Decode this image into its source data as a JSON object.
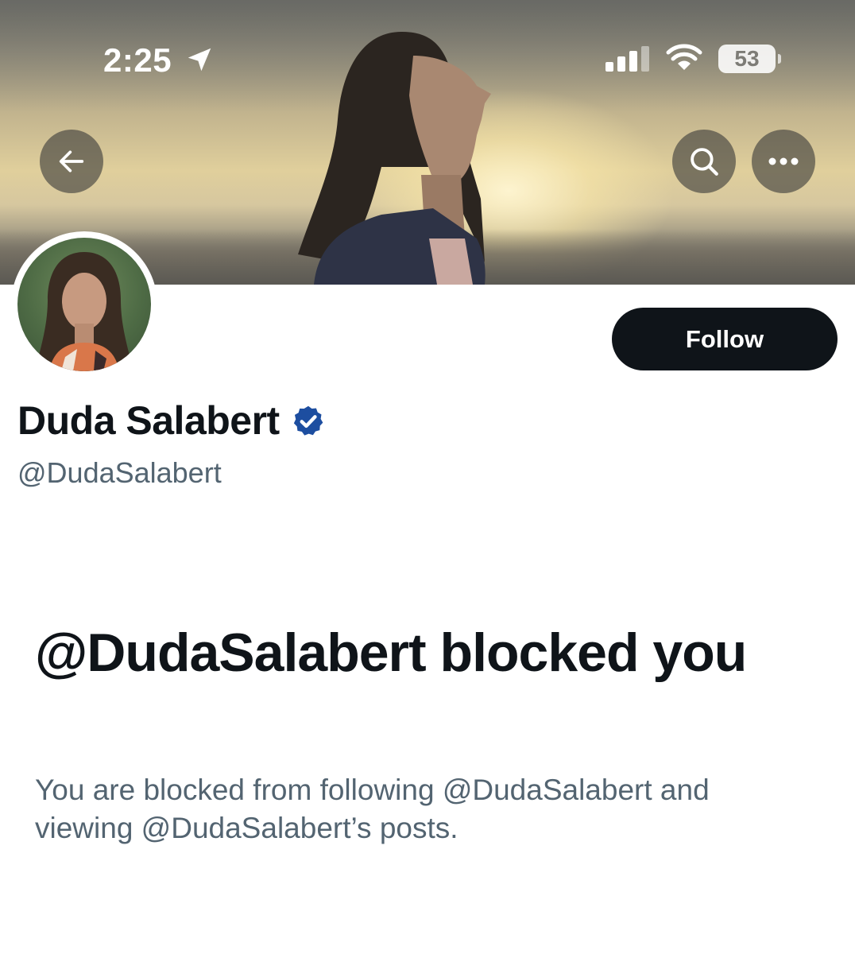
{
  "status_bar": {
    "time": "2:25",
    "battery": "53",
    "icons": [
      "location-arrow-icon",
      "cellular-signal-icon",
      "wifi-icon",
      "battery-icon"
    ]
  },
  "nav": {
    "back_icon": "arrow-left-icon",
    "search_icon": "search-icon",
    "more_icon": "more-horizontal-icon"
  },
  "profile": {
    "display_name": "Duda Salabert",
    "handle": "@DudaSalabert",
    "verified": true,
    "verified_color": "#1d4ea0",
    "follow_label": "Follow"
  },
  "blocked": {
    "title": "@DudaSalabert blocked you",
    "description": "You are blocked from following @DudaSalabert and viewing @DudaSalabert’s posts."
  },
  "colors": {
    "primary_text": "#0f1419",
    "secondary_text": "#536471",
    "follow_bg": "#0f1419",
    "follow_text": "#ffffff"
  }
}
